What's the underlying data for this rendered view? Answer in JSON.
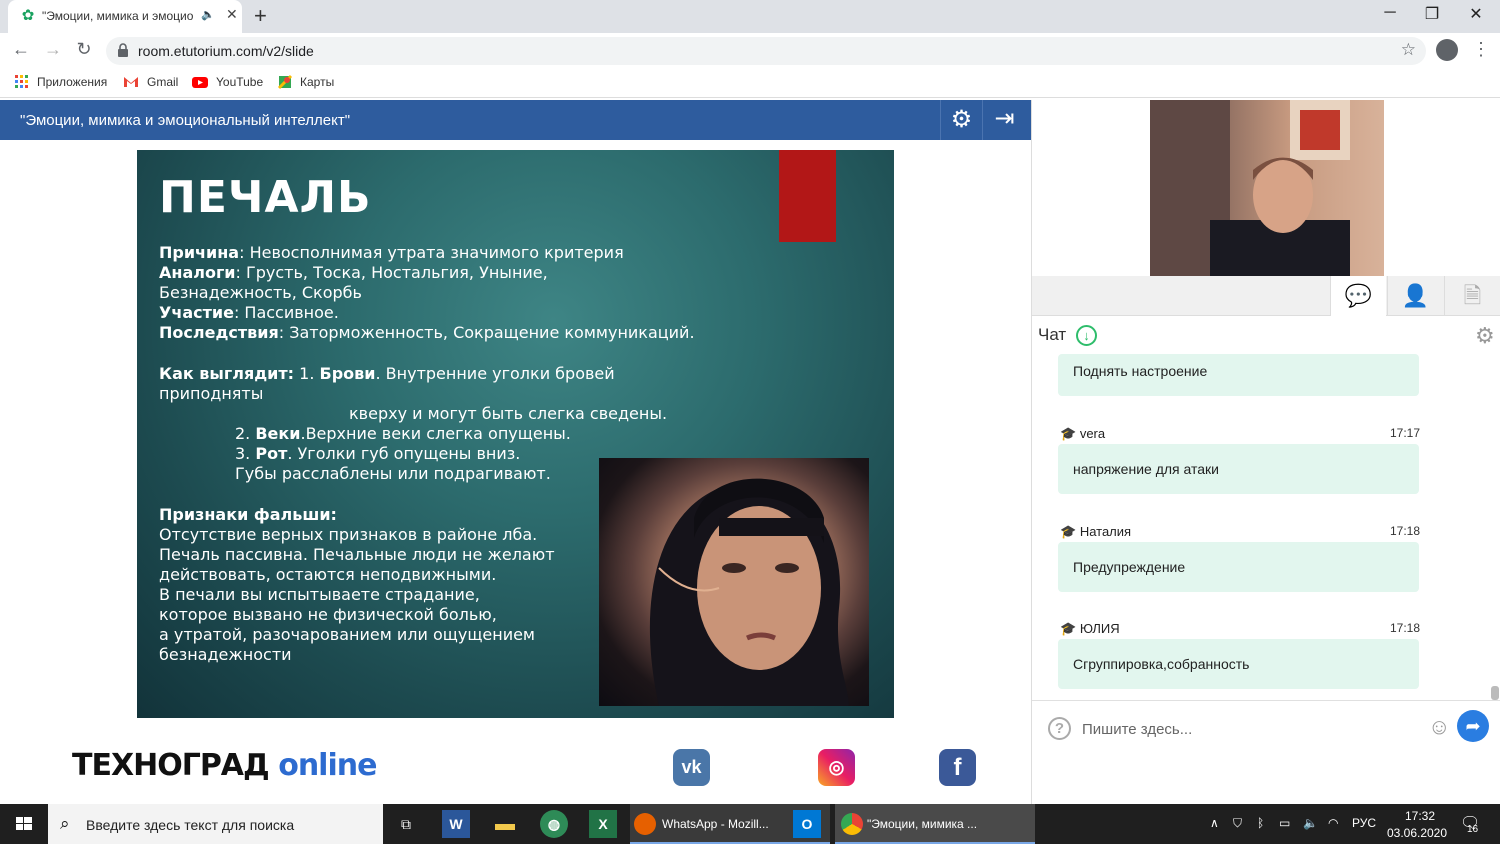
{
  "browser": {
    "tab_title": "\"Эмоции, мимика и эмоцио",
    "url": "room.etutorium.com/v2/slide",
    "bookmarks": [
      "Приложения",
      "Gmail",
      "YouTube",
      "Карты"
    ]
  },
  "app": {
    "title": "\"Эмоции, мимика и эмоциональный интеллект\""
  },
  "slide": {
    "title": "ПЕЧАЛЬ",
    "lines": [
      {
        "b": "Причина",
        "t": ":    Невосполнимая утрата значимого критерия"
      },
      {
        "b": "Аналоги",
        "t": ":           Грусть, Тоска, Ностальгия, Уныние,"
      },
      {
        "b": "",
        "t": "Безнадежность,       Скорбь"
      },
      {
        "b": "Участие",
        "t": ":    Пассивное."
      },
      {
        "b": "Последствия",
        "t": ":    Заторможенность, Сокращение коммуникаций."
      },
      {
        "b": "Как выглядит:",
        "t": "  1. "
      },
      {
        "b": "",
        "t": "приподняты"
      },
      {
        "b": "",
        "t": "кверху и могут быть слегка сведены."
      },
      {
        "b": "",
        "t": "2. "
      },
      {
        "b": "",
        "t": "3. "
      },
      {
        "b": "",
        "t": "Губы расслаблены или подрагивают."
      },
      {
        "b": "Признаки фальши:",
        "t": ""
      },
      {
        "b": "",
        "t": "Отсутствие верных признаков в районе лба."
      },
      {
        "b": "",
        "t": "Печаль пассивна. Печальные люди не желают"
      },
      {
        "b": "",
        "t": "действовать, остаются неподвижными."
      },
      {
        "b": "",
        "t": "В печали вы испытываете страдание,"
      },
      {
        "b": "",
        "t": "которое вызвано не физической болью,"
      },
      {
        "b": "",
        "t": "а утратой, разочарованием или ощущением"
      },
      {
        "b": "",
        "t": "безнадежности"
      }
    ],
    "brows_b": "Брови",
    "brows_t": ". Внутренние уголки бровей",
    "lids_b": "Веки",
    "lids_t": ".Верхние веки слегка опущены.",
    "mouth_b": "Рот",
    "mouth_t": ".   Уголки губ опущены вниз."
  },
  "footer": {
    "logo_main": "ТЕХНОГРАД",
    "logo_online": "online"
  },
  "chat": {
    "label": "Чат",
    "messages": [
      {
        "author": "",
        "time": "",
        "text": "Поднять настроение"
      },
      {
        "author": "vera",
        "time": "17:17",
        "text": "напряжение для атаки"
      },
      {
        "author": "Наталия",
        "time": "17:18",
        "text": "Предупреждение"
      },
      {
        "author": "ЮЛИЯ",
        "time": "17:18",
        "text": "Сгруппировка,собранность"
      }
    ],
    "input_placeholder": "Пишите здесь..."
  },
  "taskbar": {
    "search_placeholder": "Введите здесь текст для поиска",
    "apps": [
      "WhatsApp - Mozill...",
      "\"Эмоции, мимика ..."
    ],
    "lang": "РУС",
    "time": "17:32",
    "date": "03.06.2020",
    "notifications": "16"
  }
}
